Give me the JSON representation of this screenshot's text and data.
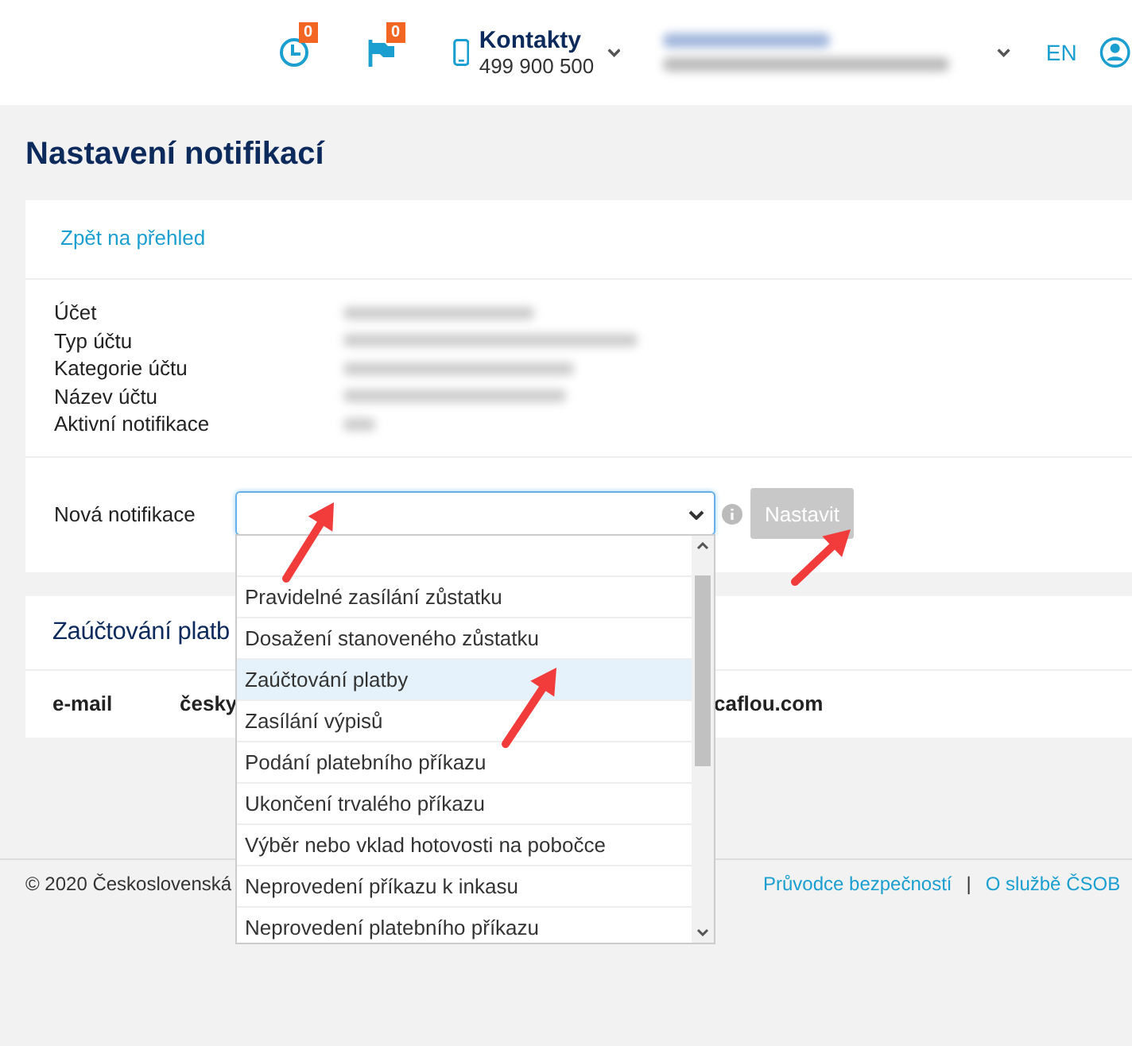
{
  "header": {
    "badges": [
      {
        "kind": "history",
        "count": "0"
      },
      {
        "kind": "flag",
        "count": "0"
      }
    ],
    "contacts": {
      "title": "Kontakty",
      "phone": "499 900 500"
    },
    "language": "EN"
  },
  "page_title": "Nastavení notifikací",
  "back_link": "Zpět na přehled",
  "account_fields": [
    "Účet",
    "Typ účtu",
    "Kategorie účtu",
    "Název účtu",
    "Aktivní notifikace"
  ],
  "new_notification": {
    "label": "Nová notifikace",
    "button": {
      "label": "Nastavit",
      "disabled": true
    }
  },
  "dropdown": {
    "expanded": true,
    "options": [
      {
        "label": "Pravidelné zasílání zůstatku",
        "selected": false
      },
      {
        "label": "Dosažení stanoveného zůstatku",
        "selected": false
      },
      {
        "label": "Zaúčtování platby",
        "selected": true
      },
      {
        "label": "Zasílání výpisů",
        "selected": false
      },
      {
        "label": "Podání platebního příkazu",
        "selected": false
      },
      {
        "label": "Ukončení trvalého příkazu",
        "selected": false
      },
      {
        "label": "Výběr nebo vklad hotovosti na pobočce",
        "selected": false
      },
      {
        "label": "Neprovedení příkazu k inkasu",
        "selected": false
      },
      {
        "label": "Neprovedení platebního příkazu",
        "selected": false
      }
    ]
  },
  "section": {
    "title": "Zaúčtování platb",
    "cells": [
      "e-mail",
      "česky",
      "caflou.com"
    ]
  },
  "footer": {
    "copyright": "© 2020 Československá",
    "links": [
      "Průvodce bezpečností",
      "O službě ČSOB"
    ],
    "separator": "|"
  }
}
